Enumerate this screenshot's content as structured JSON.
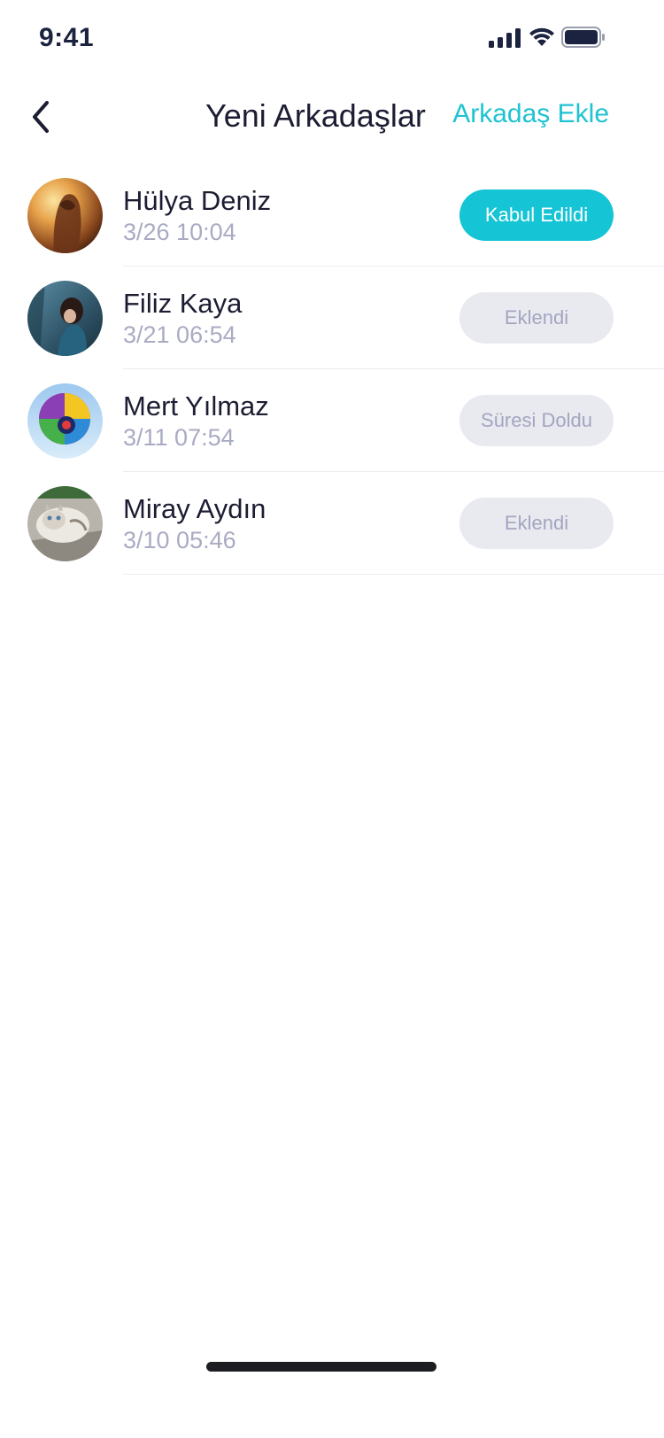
{
  "status_bar": {
    "time": "9:41"
  },
  "nav": {
    "back_icon": "chevron-left-icon",
    "title": "Yeni Arkadaşlar",
    "action_label": "Arkadaş Ekle"
  },
  "colors": {
    "accent": "#15c4d5",
    "muted_button_bg": "#e9eaf0",
    "muted_button_text": "#a3a5c0",
    "secondary_text": "#a9abc3",
    "primary_text": "#1c1d33"
  },
  "friends": [
    {
      "name": "Hülya Deniz",
      "time": "3/26 10:04",
      "status": "Kabul Edildi",
      "status_type": "primary",
      "avatar": "avatar-sunset-woman"
    },
    {
      "name": "Filiz Kaya",
      "time": "3/21 06:54",
      "status": "Eklendi",
      "status_type": "muted",
      "avatar": "avatar-sad-girl"
    },
    {
      "name": "Mert Yılmaz",
      "time": "3/11 07:54",
      "status": "Süresi Doldu",
      "status_type": "muted",
      "avatar": "avatar-hot-air-balloon"
    },
    {
      "name": "Miray Aydın",
      "time": "3/10 05:46",
      "status": "Eklendi",
      "status_type": "muted",
      "avatar": "avatar-cat"
    }
  ]
}
